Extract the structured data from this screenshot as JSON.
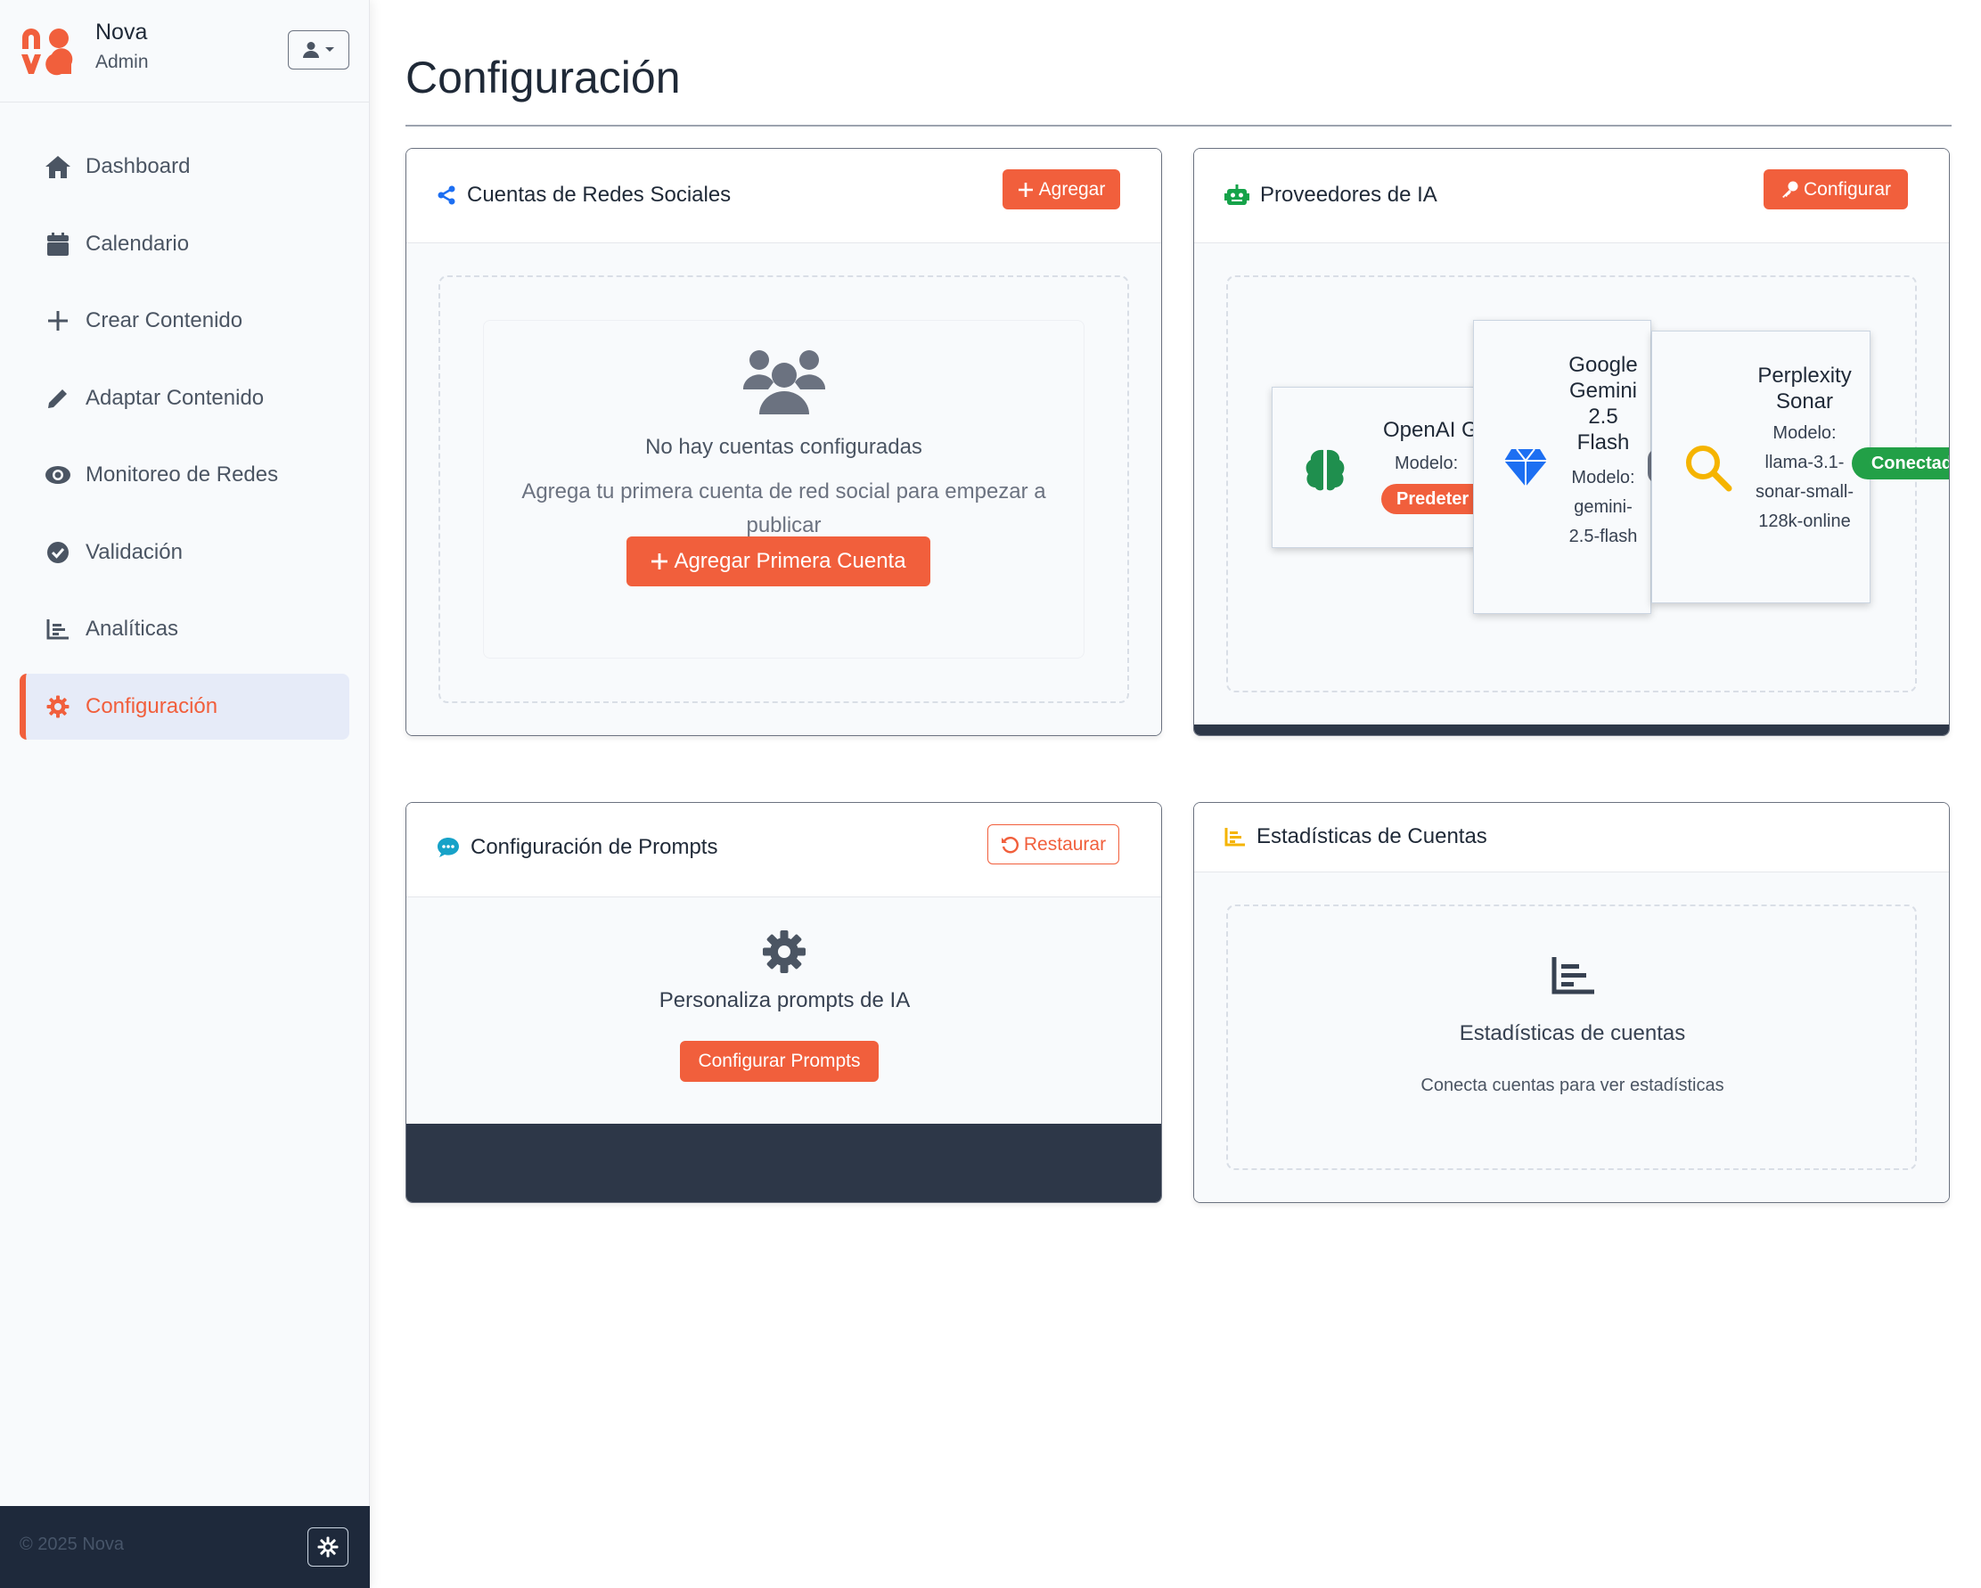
{
  "sidebar": {
    "brand_name": "Nova",
    "brand_role": "Admin",
    "items": [
      {
        "label": "Dashboard",
        "icon": "home-icon"
      },
      {
        "label": "Calendario",
        "icon": "calendar-icon"
      },
      {
        "label": "Crear Contenido",
        "icon": "plus-icon"
      },
      {
        "label": "Adaptar Contenido",
        "icon": "pencil-icon"
      },
      {
        "label": "Monitoreo de Redes",
        "icon": "eye-icon"
      },
      {
        "label": "Validación",
        "icon": "check-circle-icon"
      },
      {
        "label": "Analíticas",
        "icon": "chart-icon"
      },
      {
        "label": "Configuración",
        "icon": "gear-icon",
        "active": true
      }
    ],
    "copyright": "© 2025 Nova"
  },
  "page": {
    "title": "Configuración"
  },
  "social": {
    "title": "Cuentas de Redes Sociales",
    "add_label": "Agregar",
    "empty_title": "No hay cuentas configuradas",
    "empty_desc": "Agrega tu primera cuenta de red social para empezar a publicar",
    "add_first_label": "Agregar Primera Cuenta"
  },
  "ai": {
    "title": "Proveedores de IA",
    "configure_label": "Configurar",
    "providers": [
      {
        "name": "OpenAI G",
        "model": "Modelo:",
        "badge": "Predeter"
      },
      {
        "name": "Google Gemini 2.5 Flash",
        "model": "Modelo: gemini-2.5-flash"
      },
      {
        "name": "Perplexity Sonar",
        "model": "Modelo: llama-3.1-sonar-small-128k-online",
        "badge": "Conectado"
      }
    ]
  },
  "prompts": {
    "title": "Configuración de Prompts",
    "restore_label": "Restaurar",
    "desc": "Personaliza prompts de IA",
    "configure_label": "Configurar Prompts"
  },
  "stats": {
    "title": "Estadísticas de Cuentas",
    "heading": "Estadísticas de cuentas",
    "desc": "Conecta cuentas para ver estadísticas"
  },
  "colors": {
    "accent": "#f15f3c",
    "success": "#22a047",
    "dark": "#2d3748"
  }
}
